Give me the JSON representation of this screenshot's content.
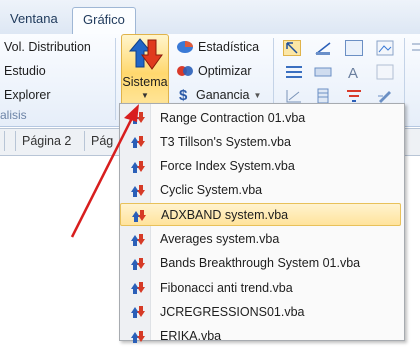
{
  "tabs": [
    {
      "label": "Ventana",
      "active": false
    },
    {
      "label": "Gráfico",
      "active": true
    }
  ],
  "ribbon": {
    "left_items": [
      "Vol. Distribution",
      "Estudio",
      "Explorer"
    ],
    "group_label": "alisis",
    "sistema_label": "Sistema",
    "small_buttons": {
      "estadistica": "Estadística",
      "optimizar": "Optimizar",
      "ganancia": "Ganancia"
    }
  },
  "sheet_tabs": [
    "Página 2",
    "Pág"
  ],
  "menu": {
    "items": [
      {
        "label": "Range Contraction 01.vba",
        "highlighted": false
      },
      {
        "label": "T3 Tillson's System.vba",
        "highlighted": false
      },
      {
        "label": "Force Index System.vba",
        "highlighted": false
      },
      {
        "label": "Cyclic System.vba",
        "highlighted": false
      },
      {
        "label": "ADXBAND system.vba",
        "highlighted": true
      },
      {
        "label": "Averages system.vba",
        "highlighted": false
      },
      {
        "label": "Bands Breakthrough System 01.vba",
        "highlighted": false
      },
      {
        "label": "Fibonacci anti trend.vba",
        "highlighted": false
      },
      {
        "label": "JCREGRESSIONS01.vba",
        "highlighted": false
      },
      {
        "label": "ERIKA.vba",
        "highlighted": false
      }
    ]
  },
  "colors": {
    "accent": "#d32f2f",
    "highlight": "#ffe39c",
    "arrow": "#d81e1e"
  }
}
